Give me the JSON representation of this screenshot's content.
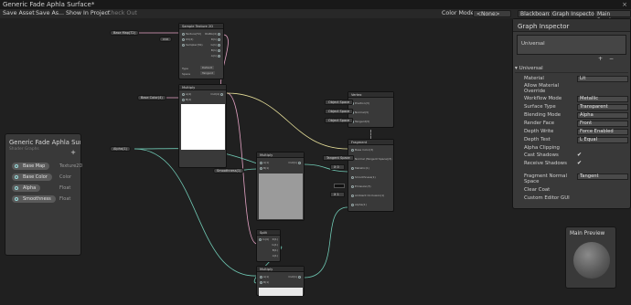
{
  "titlebar": {
    "title": "Generic Fade Aphla Surface*",
    "close": "×"
  },
  "toolbar": {
    "save_asset": "Save Asset",
    "save_as": "Save As...",
    "show_in_project": "Show In Project",
    "check_out": "Check Out",
    "color_mode_label": "Color Mode",
    "color_mode_value": "<None>",
    "blackboard_btn": "Blackboard",
    "graph_inspector_btn": "Graph Inspector",
    "main_preview_btn": "Main Preview"
  },
  "nodes": {
    "sample_tex": {
      "title": "Sample Texture 2D",
      "inputs": [
        "Texture(T2)",
        "UV(2)",
        "Sampler(SS)"
      ],
      "outputs": [
        "RGBA(4)",
        "R(1)",
        "G(1)",
        "B(1)",
        "A(1)"
      ],
      "type_label": "Type",
      "type_value": "Default",
      "space_label": "Space",
      "space_value": "Tangent"
    },
    "multiply1": {
      "title": "Multiply",
      "inputs": [
        "A(4)",
        "B(4)"
      ],
      "output": "Out(4)"
    },
    "multiply2": {
      "title": "Multiply",
      "inputs": [
        "A(1)",
        "B(1)"
      ],
      "output": "Out(1)"
    },
    "multiply3": {
      "title": "Multiply",
      "inputs": [
        "A(1)",
        "B(1)"
      ],
      "output": "Out(1)"
    },
    "split": {
      "title": "Split",
      "input": "In(4)",
      "outputs": [
        "R(1)",
        "G(1)",
        "B(1)",
        "A(1)"
      ]
    },
    "vertex": {
      "title": "Vertex",
      "slots": [
        "Position(3)",
        "Normal(3)",
        "Tangent(3)"
      ],
      "space_tags": [
        "Object Space",
        "Object Space",
        "Object Space"
      ]
    },
    "fragment": {
      "title": "Fragment",
      "slots": [
        "Base Color(3)",
        "Normal (Tangent Space)(3)",
        "Metallic(1)",
        "Smoothness(1)",
        "Emission(3)",
        "Ambient Occlusion(1)",
        "Alpha(1)"
      ],
      "normal_tag": "Tangent Space",
      "metallic_x": "X",
      "metallic_val": "0",
      "ao_x": "X",
      "ao_val": "1"
    }
  },
  "pills": {
    "base_map": "Base Map(T2)",
    "sampler_tag": "UV0",
    "base_color": "Base Color(4)",
    "alpha": "Alpha(1)",
    "smoothness": "Smoothness(1)"
  },
  "blackboard": {
    "title": "Generic Fade Aphla Surface",
    "subtitle": "Shader Graphs",
    "add": "+",
    "properties": [
      {
        "name": "Base Map",
        "type": "Texture2D"
      },
      {
        "name": "Base Color",
        "type": "Color"
      },
      {
        "name": "Alpha",
        "type": "Float"
      },
      {
        "name": "Smoothness",
        "type": "Float"
      }
    ]
  },
  "inspector": {
    "title": "Graph Inspector",
    "tab": "Universal",
    "plus": "+",
    "minus": "−",
    "section": "Universal",
    "rows": [
      {
        "label": "Material",
        "value": "Lit"
      },
      {
        "label": "Allow Material Override",
        "value": ""
      },
      {
        "label": "Workflow Mode",
        "value": "Metallic"
      },
      {
        "label": "Surface Type",
        "value": "Transparent"
      },
      {
        "label": "Blending Mode",
        "value": "Alpha"
      },
      {
        "label": "Render Face",
        "value": "Front"
      },
      {
        "label": "Depth Write",
        "value": "Force Enabled"
      },
      {
        "label": "Depth Test",
        "value": "L Equal"
      },
      {
        "label": "Alpha Clipping",
        "value": ""
      },
      {
        "label": "Cast Shadows",
        "value": "✔"
      },
      {
        "label": "Receive Shadows",
        "value": "✔"
      },
      {
        "label": "Fragment Normal Space",
        "value": "Tangent"
      },
      {
        "label": "Clear Coat",
        "value": ""
      },
      {
        "label": "Custom Editor GUI",
        "value": ""
      }
    ]
  },
  "main_preview": {
    "title": "Main Preview"
  },
  "colors": {
    "bg": "#202020",
    "panel": "#393939",
    "wire_teal": "#6fc9b4",
    "wire_pink": "#e4a3c4",
    "wire_yellow": "#e6df99"
  }
}
